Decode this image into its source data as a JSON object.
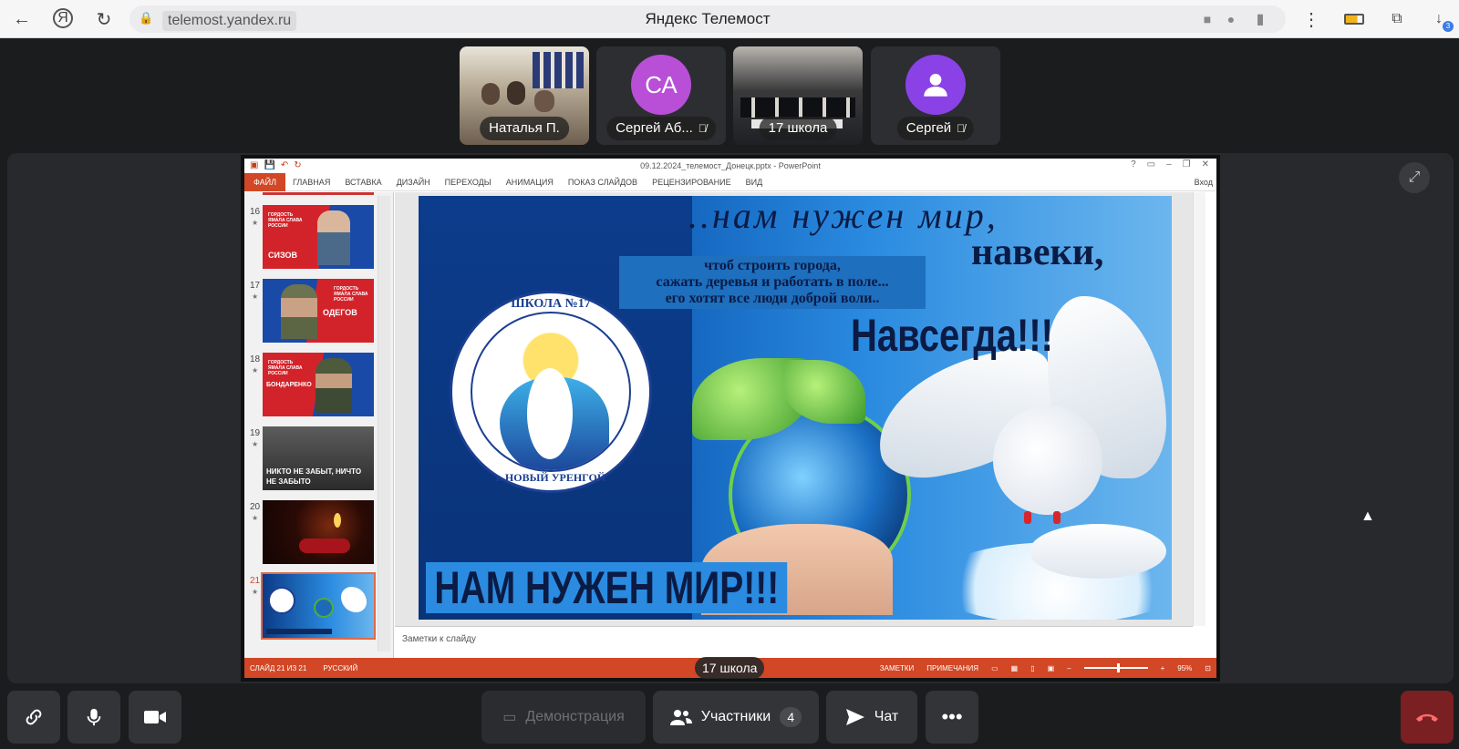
{
  "browser": {
    "url": "telemost.yandex.ru",
    "tab_title": "Яндекс Телемост",
    "downloads_badge": "3"
  },
  "participants": [
    {
      "name": "Наталья П.",
      "type": "video"
    },
    {
      "name": "Сергей Аб...",
      "initials": "СА",
      "type": "avatar",
      "muted": true,
      "color": "#b84fd6"
    },
    {
      "name": "17 школа",
      "type": "video"
    },
    {
      "name": "Сергей",
      "type": "avatar-icon",
      "muted": true,
      "color": "#8a42e6"
    }
  ],
  "powerpoint": {
    "title": "09.12.2024_телемост_Донецк.pptx - PowerPoint",
    "tabs": [
      "ФАЙЛ",
      "ГЛАВНАЯ",
      "ВСТАВКА",
      "ДИЗАЙН",
      "ПЕРЕХОДЫ",
      "АНИМАЦИЯ",
      "ПОКАЗ СЛАЙДОВ",
      "РЕЦЕНЗИРОВАНИЕ",
      "ВИД"
    ],
    "signin": "Вход",
    "thumbnails": [
      {
        "num": "16",
        "text": "СИЗОВ",
        "banner": "ГОРДОСТЬ ЯМАЛА СЛАВА РОССИИ"
      },
      {
        "num": "17",
        "text": "ОДЕГОВ",
        "banner": "ГОРДОСТЬ ЯМАЛА СЛАВА РОССИИ"
      },
      {
        "num": "18",
        "text": "БОНДАРЕНКО",
        "banner": "ГОРДОСТЬ ЯМАЛА СЛАВА РОССИИ"
      },
      {
        "num": "19",
        "text": "НИКТО НЕ ЗАБЫТ, НИЧТО НЕ ЗАБЫТО"
      },
      {
        "num": "20",
        "text": ""
      },
      {
        "num": "21",
        "text": ""
      }
    ],
    "notes_placeholder": "Заметки к слайду",
    "status": {
      "slide": "СЛАЙД 21 ИЗ 21",
      "lang": "РУССКИЙ",
      "notes": "ЗАМЕТКИ",
      "comments": "ПРИМЕЧАНИЯ",
      "zoom": "95%"
    },
    "slide": {
      "line1": "..нам нужен мир,",
      "line2": "навеки,",
      "line3": "Навсегда!!!",
      "verse": [
        "чтоб строить города,",
        "сажать деревья и работать в поле...",
        "его хотят все люди доброй воли.."
      ],
      "logo_top": "ШКОЛА №17",
      "logo_bottom": "г. НОВЫЙ УРЕНГОЙ",
      "banner": "НАМ НУЖЕН МИР!!!"
    }
  },
  "stage_caption": "17 школа",
  "toolbar": {
    "demo": "Демонстрация",
    "participants": "Участники",
    "participants_count": "4",
    "chat": "Чат"
  }
}
